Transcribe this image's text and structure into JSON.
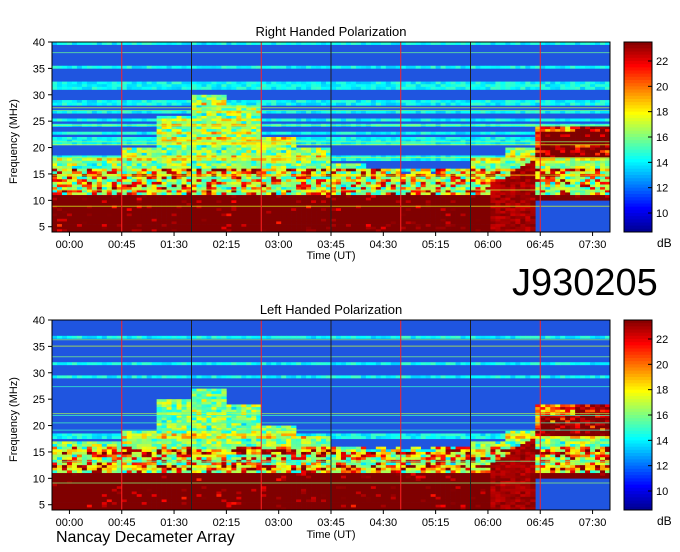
{
  "figure_id": "J930205",
  "credit": "Nancay Decameter Array",
  "colors": {
    "colormap": [
      "#00008f",
      "#0000ff",
      "#0080ff",
      "#00ffff",
      "#80ff80",
      "#ffff00",
      "#ff8000",
      "#ff0000",
      "#800000"
    ],
    "burst": "#8b0000",
    "background": "#1a4fd6",
    "vline_red": "#ff2020",
    "vline_dark": "#202020"
  },
  "chart_data": [
    {
      "type": "heatmap",
      "title": "Right Handed Polarization",
      "xlabel": "Time (UT)",
      "ylabel": "Frequency (MHz)",
      "x_ticks": [
        "00:00",
        "00:45",
        "01:30",
        "02:15",
        "03:00",
        "03:45",
        "04:30",
        "05:15",
        "06:00",
        "06:45",
        "07:30"
      ],
      "x_range_hours": [
        -0.25,
        7.75
      ],
      "y_ticks": [
        5,
        10,
        15,
        20,
        25,
        30,
        35,
        40
      ],
      "ylim": [
        4,
        40
      ],
      "colorbar": {
        "ticks": [
          10,
          12,
          14,
          16,
          18,
          20,
          22
        ],
        "range": [
          8.5,
          23.5
        ],
        "unit": "dB"
      },
      "vertical_markers_hours": [
        0.75,
        1.75,
        2.75,
        3.75,
        4.75,
        5.75,
        6.75
      ],
      "features": {
        "emission_upper_freq_mhz": [
          18,
          18,
          20,
          26,
          30,
          28,
          22,
          20,
          17,
          16,
          15,
          16,
          18,
          20,
          23,
          24
        ]
      }
    },
    {
      "type": "heatmap",
      "title": "Left Handed Polarization",
      "xlabel": "Time (UT)",
      "ylabel": "Frequency (MHz)",
      "x_ticks": [
        "00:00",
        "00:45",
        "01:30",
        "02:15",
        "03:00",
        "03:45",
        "04:30",
        "05:15",
        "06:00",
        "06:45",
        "07:30"
      ],
      "x_range_hours": [
        -0.25,
        7.75
      ],
      "y_ticks": [
        5,
        10,
        15,
        20,
        25,
        30,
        35,
        40
      ],
      "ylim": [
        4,
        40
      ],
      "colorbar": {
        "ticks": [
          10,
          12,
          14,
          16,
          18,
          20,
          22
        ],
        "range": [
          8.5,
          23.5
        ],
        "unit": "dB"
      },
      "vertical_markers_hours": [
        0.75,
        1.75,
        2.75,
        3.75,
        4.75,
        5.75,
        6.75
      ],
      "features": {
        "emission_upper_freq_mhz": [
          17,
          17,
          19,
          25,
          27,
          24,
          20,
          18,
          16,
          15,
          15,
          16,
          17,
          19,
          22,
          24
        ]
      }
    }
  ]
}
